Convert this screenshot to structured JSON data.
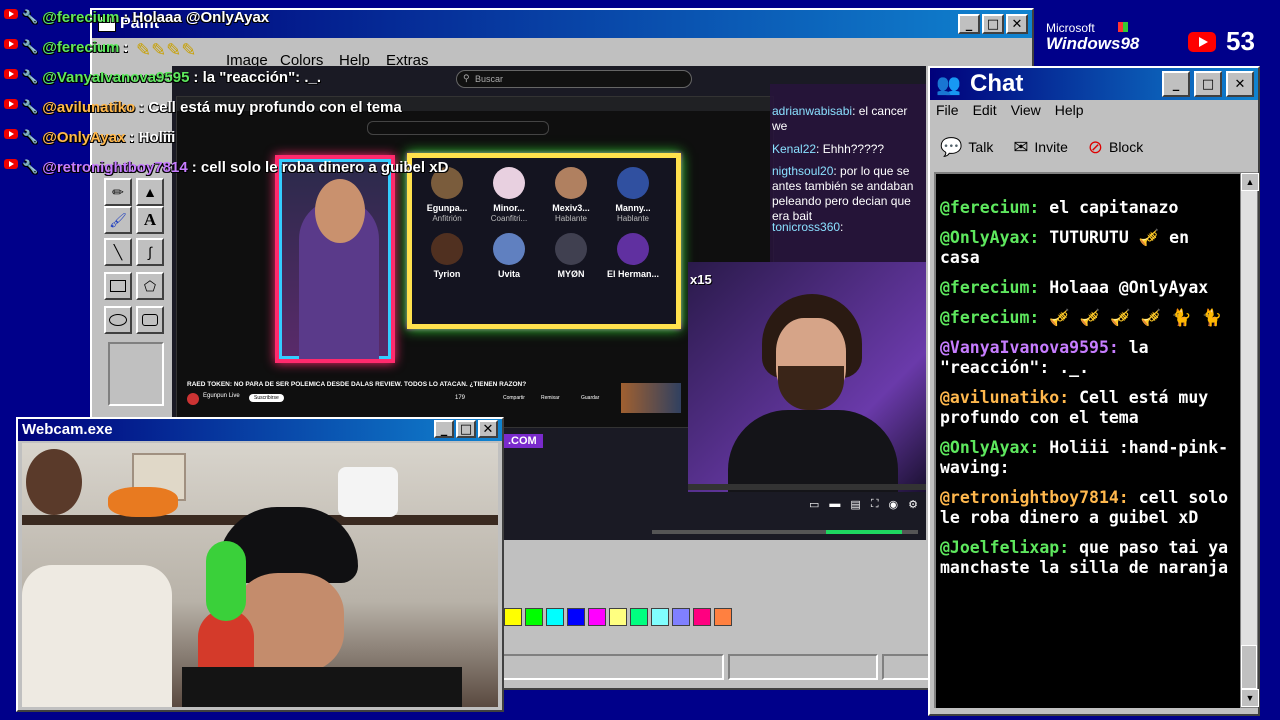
{
  "overlay_chat": [
    {
      "user": "@ferecium",
      "text": ": Holaaa @OnlyAyax",
      "color": "#5ee85e"
    },
    {
      "user": "@ferecium",
      "text": ":",
      "color": "#5ee85e"
    },
    {
      "user": "@VanyaIvanova9595",
      "text": ": la \"reacción\": ._.",
      "color": "#5ee85e"
    },
    {
      "user": "@avilunatiko",
      "text": ": Cell está muy profundo con el tema",
      "color": "#ffb84d"
    },
    {
      "user": "@OnlyAyax",
      "text": ": Holiii",
      "color": "#ffb84d"
    },
    {
      "user": "@retronightboy7814",
      "text": ": cell solo le roba dinero a guibel xD",
      "color": "#c77dff"
    }
  ],
  "paint": {
    "title": "Paint",
    "menu": {
      "image": "Image",
      "colors": "Colors",
      "help": "Help",
      "extras": "Extras"
    },
    "tools": [
      "pencil-icon",
      "brush-icon",
      "fill-icon",
      "text-icon",
      "line-icon",
      "curve-icon",
      "rectangle-icon",
      "polygon-icon",
      "ellipse-icon",
      "rounded-rect-icon"
    ],
    "text_tool_label": "A",
    "palette": [
      "#ffff00",
      "#00ff00",
      "#00ffff",
      "#0000ff",
      "#ff00ff",
      "#ffff80",
      "#00ff80",
      "#80ffff",
      "#8080ff",
      "#ff0080",
      "#ff8040"
    ]
  },
  "stream": {
    "search_placeholder": "Buscar",
    "yt_chat": [
      {
        "user": "adrianwabisabi",
        "text": ": el cancer we"
      },
      {
        "user": "Kenal22",
        "text": ": Ehhh?????"
      },
      {
        "user": "nigthsoul20",
        "text": ": por lo que se antes también se andaban peleando pero decian que era bait"
      },
      {
        "user": "tonicross360",
        "text": ":"
      }
    ],
    "guests": [
      {
        "name": "Egunpa...",
        "role": "Anfitrión",
        "color": "#7a5c3c"
      },
      {
        "name": "Minor...",
        "role": "Coanfitri...",
        "color": "#e8d0e0"
      },
      {
        "name": "Mexiv3...",
        "role": "Hablante",
        "color": "#b08060"
      },
      {
        "name": "Manny...",
        "role": "Hablante",
        "color": "#3050a0"
      },
      {
        "name": "Tyrion",
        "role": "",
        "color": "#503020"
      },
      {
        "name": "Uvita",
        "role": "",
        "color": "#6080c0"
      },
      {
        "name": "MYØN",
        "role": "",
        "color": "#404050"
      },
      {
        "name": "El Herman...",
        "role": "",
        "color": "#6030a0"
      }
    ],
    "video_title": "RAED TOKEN: NO PARA DE SER POLEMICA DESDE DALAS REVIEW. TODOS LO ATACAN. ¿TIENEN RAZON?",
    "channel": "Egunpun Live",
    "subscribe_label": "Suscribirse",
    "action_buttons": [
      "Compartir",
      "Remixar",
      "Guardar"
    ],
    "like_count": "179",
    "multiplier": "x15",
    "url_fragment": ".COM"
  },
  "webcam": {
    "title": "Webcam.exe"
  },
  "top_right": {
    "brand_top": "Microsoft",
    "brand_bottom": "Windows98",
    "viewer_count": "53"
  },
  "chat": {
    "title": "Chat",
    "menu": {
      "file": "File",
      "edit": "Edit",
      "view": "View",
      "help": "Help"
    },
    "toolbar": {
      "talk": "Talk",
      "invite": "Invite",
      "block": "Block"
    },
    "messages": [
      {
        "user": "@ferecium:",
        "text": "el capitanazo",
        "cls": "u-green"
      },
      {
        "user": "@OnlyAyax:",
        "text": "TUTURUTU 🎺 en casa",
        "cls": "u-green"
      },
      {
        "user": "@ferecium:",
        "text": "Holaaa @OnlyAyax",
        "cls": "u-green"
      },
      {
        "user": "@ferecium:",
        "text": "🎺 🎺 🎺 🎺 🐈 🐈",
        "cls": "u-green"
      },
      {
        "user": "@VanyaIvanova9595:",
        "text": "la \"reacción\": ._.",
        "cls": "u-purple"
      },
      {
        "user": "@avilunatiko:",
        "text": "Cell está muy profundo con el tema",
        "cls": "u-orange"
      },
      {
        "user": "@OnlyAyax:",
        "text": "Holiii :hand-pink-waving:",
        "cls": "u-green"
      },
      {
        "user": "@retronightboy7814:",
        "text": "cell solo le roba dinero a guibel xD",
        "cls": "u-orange"
      },
      {
        "user": "@Joelfelixap:",
        "text": "que paso tai ya manchaste la silla de naranja",
        "cls": "u-green"
      }
    ]
  }
}
